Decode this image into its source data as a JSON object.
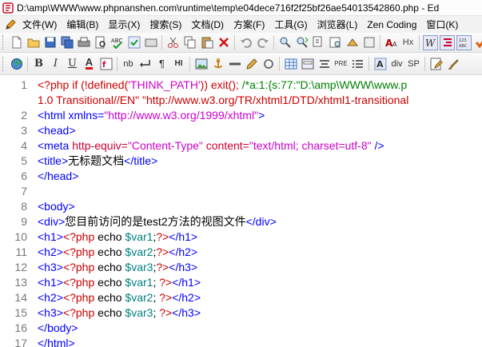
{
  "window": {
    "title": "D:\\amp\\WWW\\www.phpnanshen.com\\runtime\\temp\\e04dece716f2f25bf26ae54013542860.php - Ed"
  },
  "menu": {
    "items": [
      "文件(W)",
      "编辑(B)",
      "显示(X)",
      "搜索(S)",
      "文档(D)",
      "方案(F)",
      "工具(G)",
      "浏览器(L)",
      "Zen Coding",
      "窗口(K)"
    ]
  },
  "editor": {
    "line_numbers": [
      "1",
      "",
      "2",
      "3",
      "4",
      "5",
      "6",
      "7",
      "8",
      "9",
      "10",
      "11",
      "12",
      "13",
      "14",
      "15",
      "16",
      "17"
    ],
    "line1a_open": "<?php if (!defined(",
    "line1a_str": "'THINK_PATH'",
    "line1a_close": ")) exit(); ",
    "line1a_cmt": "/*a:1:{s:77:\"D:\\amp\\WWW\\www.p",
    "line1b_text": "1.0 Transitional//EN\" \"http://www.w3.org/TR/xhtml1/DTD/xhtml1-transitional",
    "line2_tag": "<html xmlns=",
    "line2_val": "\"http://www.w3.org/1999/xhtml\"",
    "line2_end": ">",
    "line3": "<head>",
    "line4_tag": "<meta ",
    "line4_attr1": "http-equiv=",
    "line4_val1": "\"Content-Type\"",
    "line4_attr2": " content=",
    "line4_val2": "\"text/html; charset=utf-8\"",
    "line4_end": " />",
    "line5_open": "<title>",
    "line5_text": "无标题文档",
    "line5_close": "</title>",
    "line6": "</head>",
    "line8": "<body>",
    "line9_open": "<div>",
    "line9_text": "您目前访问的是test2方法的视图文件",
    "line9_close": "</div>",
    "rows": [
      {
        "open": "<h1>",
        "echo": " echo ",
        "var": "$var1",
        "semi": ";",
        "close": "</h1>"
      },
      {
        "open": "<h2>",
        "echo": " echo ",
        "var": "$var2",
        "semi": ";",
        "close": "</h2>"
      },
      {
        "open": "<h3>",
        "echo": " echo ",
        "var": "$var3",
        "semi": ";",
        "close": "</h3>"
      },
      {
        "open": "<h1>",
        "echo": " echo ",
        "var": "$var1",
        "semi": "; ",
        "close": "</h1>"
      },
      {
        "open": "<h2>",
        "echo": " echo ",
        "var": "$var2",
        "semi": "; ",
        "close": "</h2>"
      },
      {
        "open": "<h3>",
        "echo": " echo ",
        "var": "$var3",
        "semi": "; ",
        "close": "</h3>"
      }
    ],
    "php_open": "<?php",
    "php_close": "?>",
    "line16": "</body>",
    "line17": "</html>"
  },
  "toolbar2": {
    "bold": "B",
    "italic": "I",
    "underline": "U",
    "font_color": "A",
    "nbsp": "nb",
    "para": "¶",
    "hr": "HI",
    "pre": "PRE",
    "div": "div",
    "sp": "SP",
    "hx": "Hx"
  }
}
